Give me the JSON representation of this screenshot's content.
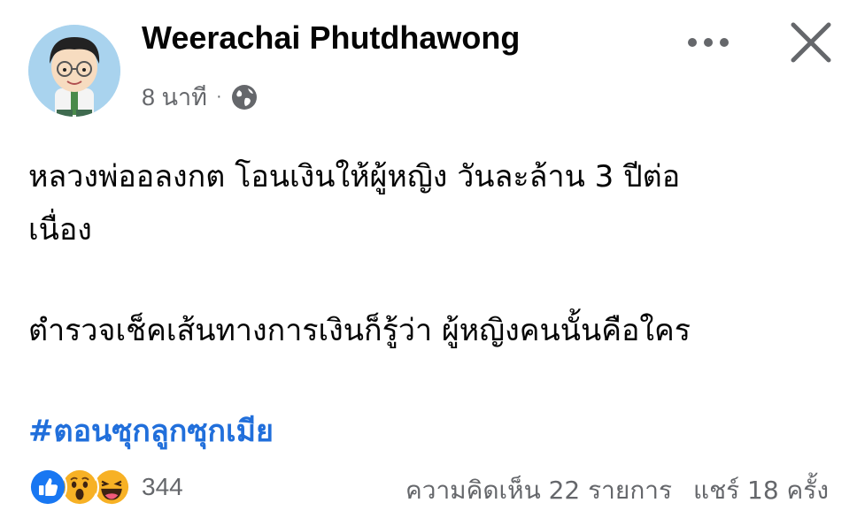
{
  "post": {
    "author_name": "Weerachai Phutdhawong",
    "time": "8 นาที",
    "separator": "·",
    "privacy_icon": "globe-icon",
    "body_lines": [
      "หลวงพ่ออลงกต โอนเงินให้ผู้หญิง วันละล้าน 3 ปีต่อ",
      "เนื่อง",
      "ตำรวจเช็คเส้นทางการเงินก็รู้ว่า ผู้หญิงคนนั้นคือใคร"
    ],
    "hashtag": "#ตอนซุกลูกซุกเมีย"
  },
  "footer": {
    "reactions": [
      "like-icon",
      "wow-icon",
      "haha-icon"
    ],
    "reaction_count": "344",
    "comments_label": "ความคิดเห็น 22 รายการ",
    "shares_label": "แชร์ 18 ครั้ง"
  },
  "colors": {
    "hashtag": "#216fdb",
    "secondary_text": "#65676b",
    "like_blue": "#1877f2",
    "emoji_yellow": "#f7b125"
  }
}
